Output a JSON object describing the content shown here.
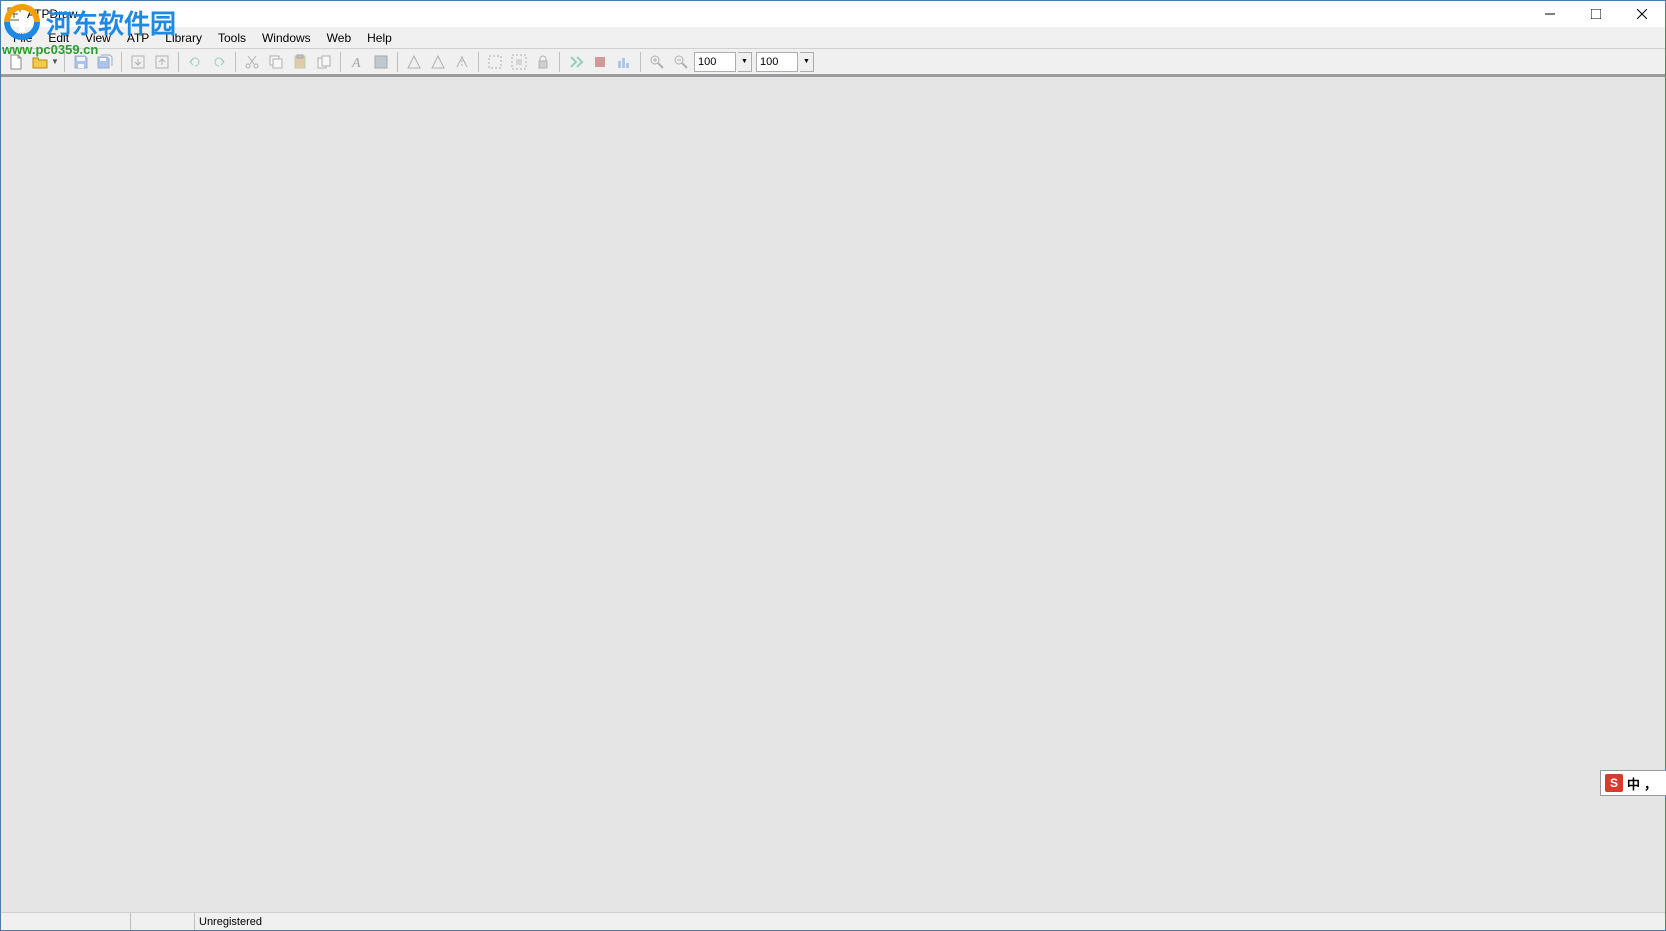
{
  "titlebar": {
    "title": "ATPDraw"
  },
  "menu": {
    "items": [
      "File",
      "Edit",
      "View",
      "ATP",
      "Library",
      "Tools",
      "Windows",
      "Web",
      "Help"
    ]
  },
  "toolbar": {
    "zoom1": "100",
    "zoom2": "100"
  },
  "statusbar": {
    "text": "Unregistered"
  },
  "watermark": {
    "text": "河东软件园",
    "url": "www.pc0359.cn"
  },
  "ime": {
    "logo": "S",
    "lang": "中",
    "punct": "，"
  }
}
